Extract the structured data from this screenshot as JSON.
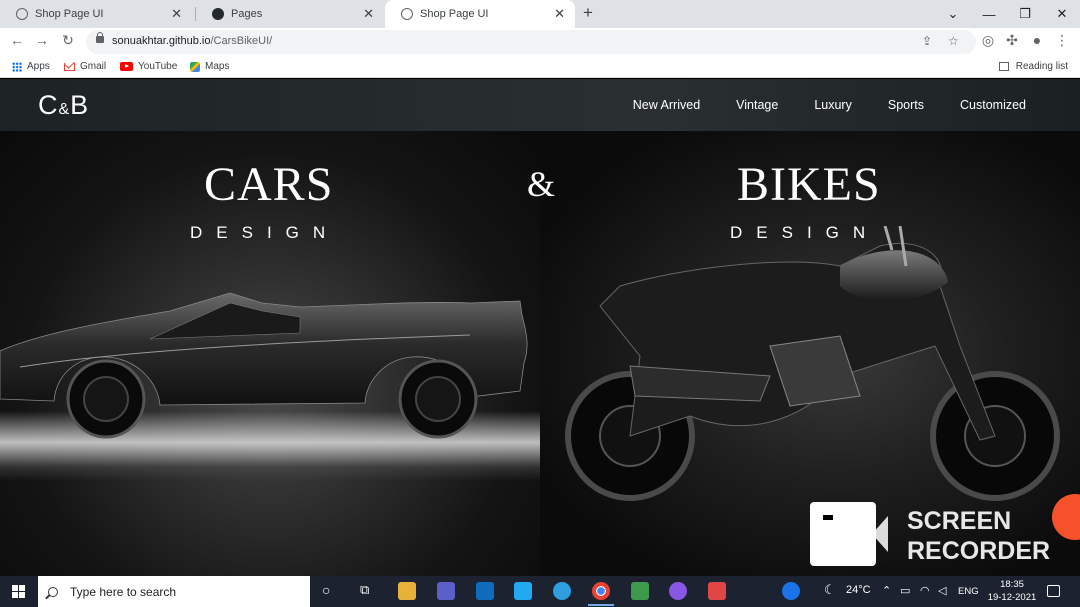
{
  "browser": {
    "tabs": [
      {
        "title": "Shop Page UI",
        "close": "✕"
      },
      {
        "title": "Pages",
        "close": "✕"
      },
      {
        "title": "Shop Page UI",
        "close": "✕"
      }
    ],
    "new_tab": "+",
    "window_controls": {
      "menu": "⌄",
      "minimize": "—",
      "restore": "❐",
      "close": "✕"
    },
    "url_host": "sonuakhtar.github.io",
    "url_path": "/CarsBikeUI/",
    "bookmarks": [
      {
        "label": "Apps",
        "icon": "apps-grid-icon"
      },
      {
        "label": "Gmail",
        "icon": "gmail-icon"
      },
      {
        "label": "YouTube",
        "icon": "youtube-icon"
      },
      {
        "label": "Maps",
        "icon": "maps-icon"
      }
    ],
    "reading_list": "Reading list"
  },
  "site": {
    "logo_c": "C",
    "logo_amp": "&",
    "logo_b": "B",
    "nav": [
      "New Arrived",
      "Vintage",
      "Luxury",
      "Sports",
      "Customized"
    ],
    "left_title": "CARS",
    "left_sub": "DESIGN",
    "ampersand": "&",
    "right_title": "BIKES",
    "right_sub": "DESIGN"
  },
  "recorder": {
    "line1": "SCREEN",
    "line2": "RECORDER"
  },
  "taskbar": {
    "search_placeholder": "Type here to search",
    "weather": "24°C",
    "language": "ENG",
    "time": "18:35",
    "date": "19-12-2021"
  }
}
